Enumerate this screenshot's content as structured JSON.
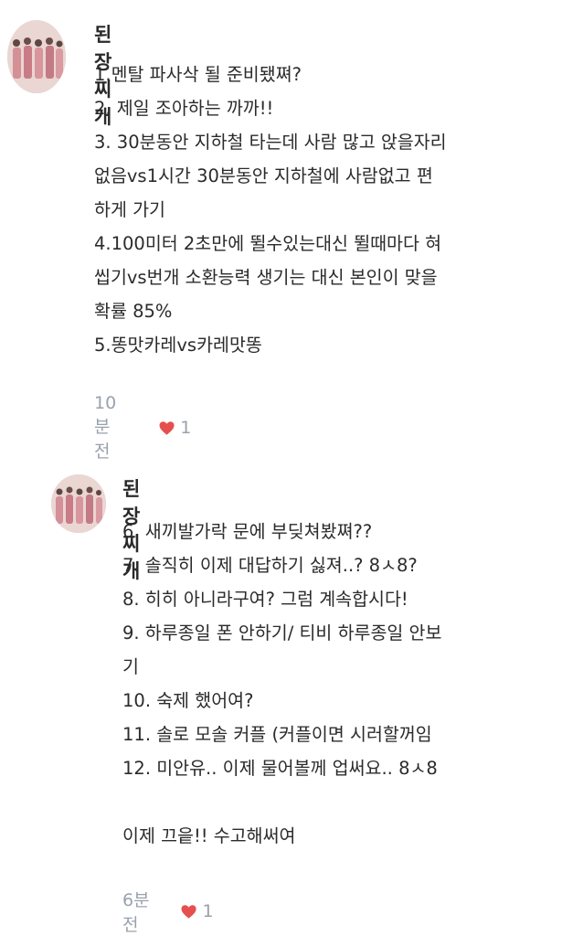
{
  "comments": [
    {
      "author": "된장찌개",
      "lines": [
        "1.멘탈 파사삭 될 준비됐쪄?",
        "2. 제일 조아하는 까까!!",
        "3. 30분동안 지하철 타는데 사람 많고 앉을자리",
        "없음vs1시간 30분동안 지하철에 사람없고 편",
        "하게 가기",
        "4.100미터 2초만에 뛸수있는대신 뛸때마다 혀",
        "씹기vs번개 소환능력 생기는 대신 본인이 맞을",
        "확률 85%",
        "5.똥맛카레vs카레맛똥"
      ],
      "time": "10분 전",
      "likes": "1"
    },
    {
      "author": "된장찌개",
      "lines": [
        "6. 새끼발가락 문에 부딪쳐봤쪄??",
        "7. 솔직히 이제 대답하기 싫져..? 8ㅅ8?",
        "8. 히히 아니라구여? 그럼 계속합시다!",
        "9. 하루종일 폰 안하기/ 티비 하루종일 안보",
        "기",
        "10. 숙제 했어여?",
        "11. 솔로 모솔 커플 (커플이면 시러할꺼임",
        "12. 미안유.. 이제 물어볼께 업써요.. 8ㅅ8",
        "",
        "이제 끄읕!! 수고해써여"
      ],
      "time": "6분 전",
      "likes": "1"
    }
  ],
  "colors": {
    "heart": "#e5504f",
    "meta": "#9aa1ad",
    "text": "#2b2b2b"
  },
  "icons": {
    "avatar": "group-photo-avatar",
    "like": "heart-icon"
  }
}
